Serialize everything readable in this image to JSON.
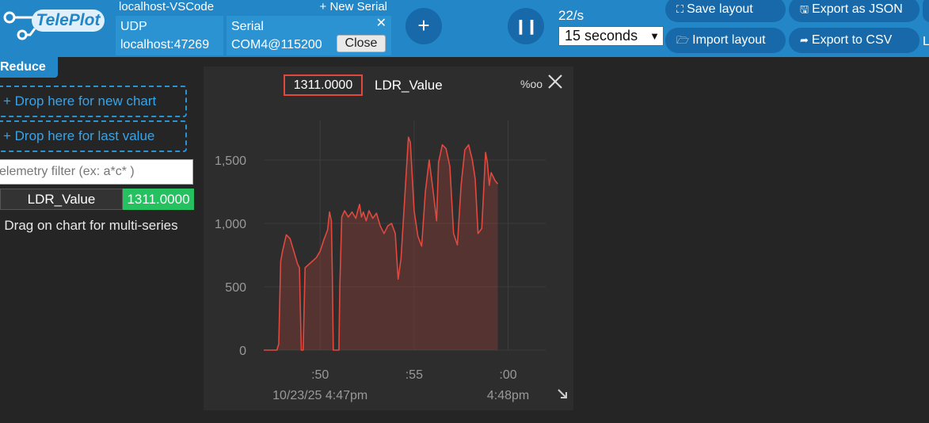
{
  "app": {
    "logo_text": "TelePlot"
  },
  "connection": {
    "host_label": "localhost-VSCode",
    "new_serial_label": "+ New Serial",
    "udp": {
      "type": "UDP",
      "address": "localhost:47269"
    },
    "serial": {
      "type": "Serial",
      "port": "COM4@115200",
      "close_label": "Close",
      "remove_glyph": "✕"
    }
  },
  "controls": {
    "add_glyph": "+",
    "pause_glyph": "❙❙",
    "rate": "22/s",
    "timespan": "15 seconds"
  },
  "toolbar": {
    "save_layout": "Save layout",
    "import_layout": "Import layout",
    "export_json": "Export as JSON",
    "export_csv": "Export to CSV",
    "edge_char": "L"
  },
  "sidebar": {
    "reduce_label": "Reduce",
    "drop_new": "+ Drop here for new chart",
    "drop_last": "+ Drop here for last value",
    "filter_placeholder": "elemetry filter (ex: a*c* )",
    "telemetry": [
      {
        "name": "LDR_Value",
        "value": "1311.0000"
      }
    ],
    "hint": "Drag on chart for multi-series"
  },
  "chart_widget": {
    "current_value": "1311.0000",
    "series_name": "LDR_Value",
    "unit_glyph": "%oo"
  },
  "colors": {
    "accent": "#2386c7",
    "series": "#e1493f",
    "value_bg": "#25c05f"
  },
  "chart_data": {
    "type": "area",
    "series": [
      {
        "name": "LDR_Value",
        "color": "#e1493f"
      }
    ],
    "ylim": [
      0,
      1750
    ],
    "yticks": [
      0,
      500,
      1000,
      1500
    ],
    "ytick_labels": [
      "0",
      "500",
      "1,000",
      "1,500"
    ],
    "xlim": [
      0,
      15
    ],
    "xticks": [
      3,
      8,
      13
    ],
    "xtick_labels": [
      ":50",
      ":55",
      ":00"
    ],
    "xdate_labels": [
      "10/23/25 4:47pm",
      "",
      "4:48pm"
    ],
    "points": [
      [
        0,
        0
      ],
      [
        0.7,
        0
      ],
      [
        0.8,
        50
      ],
      [
        0.9,
        700
      ],
      [
        1.0,
        780
      ],
      [
        1.2,
        910
      ],
      [
        1.4,
        880
      ],
      [
        1.6,
        780
      ],
      [
        1.8,
        680
      ],
      [
        1.9,
        650
      ],
      [
        1.95,
        300
      ],
      [
        2.0,
        0
      ],
      [
        2.1,
        0
      ],
      [
        2.2,
        650
      ],
      [
        2.5,
        690
      ],
      [
        2.8,
        730
      ],
      [
        3.0,
        780
      ],
      [
        3.2,
        870
      ],
      [
        3.4,
        950
      ],
      [
        3.5,
        1090
      ],
      [
        3.6,
        1020
      ],
      [
        3.65,
        600
      ],
      [
        3.7,
        0
      ],
      [
        4.0,
        0
      ],
      [
        4.05,
        500
      ],
      [
        4.15,
        1050
      ],
      [
        4.3,
        1100
      ],
      [
        4.5,
        1050
      ],
      [
        4.7,
        1090
      ],
      [
        4.9,
        1040
      ],
      [
        5.0,
        1100
      ],
      [
        5.1,
        1150
      ],
      [
        5.2,
        1050
      ],
      [
        5.3,
        1090
      ],
      [
        5.45,
        1020
      ],
      [
        5.6,
        1100
      ],
      [
        5.8,
        1040
      ],
      [
        6.0,
        1080
      ],
      [
        6.2,
        980
      ],
      [
        6.4,
        920
      ],
      [
        6.6,
        980
      ],
      [
        6.8,
        1000
      ],
      [
        7.0,
        920
      ],
      [
        7.15,
        560
      ],
      [
        7.3,
        720
      ],
      [
        7.5,
        1200
      ],
      [
        7.7,
        1680
      ],
      [
        7.8,
        1640
      ],
      [
        8.0,
        1100
      ],
      [
        8.2,
        900
      ],
      [
        8.4,
        820
      ],
      [
        8.6,
        1250
      ],
      [
        8.8,
        1500
      ],
      [
        9.0,
        1270
      ],
      [
        9.2,
        1020
      ],
      [
        9.3,
        1480
      ],
      [
        9.5,
        1620
      ],
      [
        9.7,
        1590
      ],
      [
        9.9,
        1450
      ],
      [
        10.1,
        920
      ],
      [
        10.3,
        830
      ],
      [
        10.5,
        1300
      ],
      [
        10.7,
        1580
      ],
      [
        10.9,
        1620
      ],
      [
        11.1,
        1500
      ],
      [
        11.25,
        1350
      ],
      [
        11.4,
        920
      ],
      [
        11.6,
        960
      ],
      [
        11.8,
        1560
      ],
      [
        11.9,
        1480
      ],
      [
        12.0,
        1300
      ],
      [
        12.1,
        1400
      ],
      [
        12.3,
        1340
      ],
      [
        12.4,
        1320
      ],
      [
        12.45,
        1311
      ]
    ]
  }
}
